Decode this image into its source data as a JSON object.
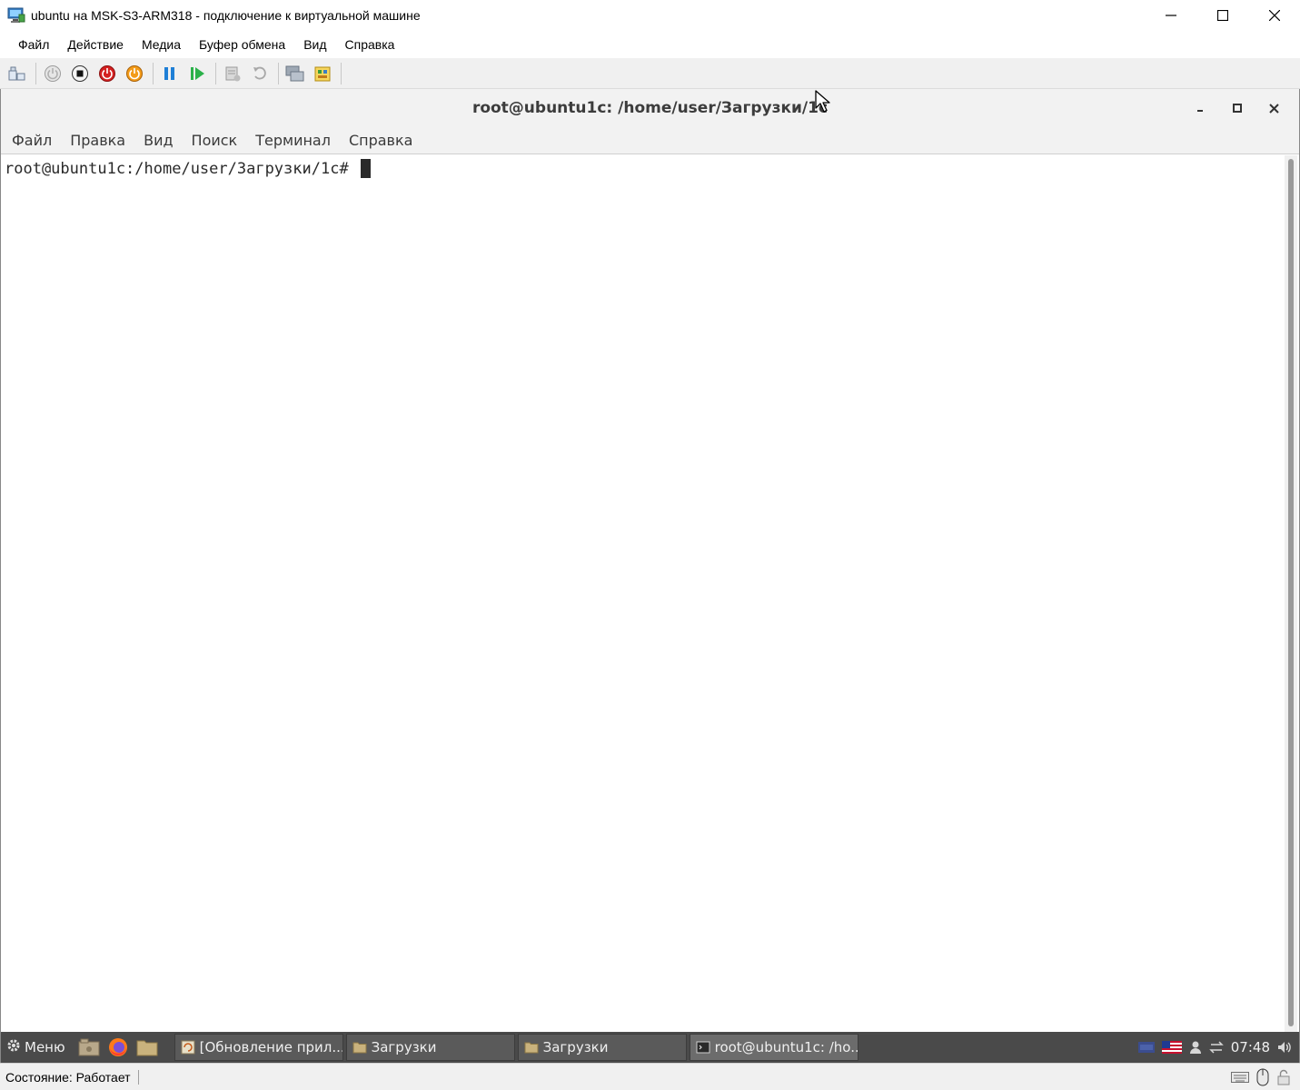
{
  "host": {
    "title": "ubuntu на MSK-S3-ARM318 - подключение к виртуальной машине",
    "menu": [
      "Файл",
      "Действие",
      "Медиа",
      "Буфер обмена",
      "Вид",
      "Справка"
    ],
    "toolbar_icons": [
      "ctrl-alt-del-icon",
      "start-icon",
      "turn-off-icon",
      "shutdown-icon",
      "save-state-icon",
      "pause-icon",
      "resume-icon",
      "checkpoint-icon",
      "revert-icon",
      "enhanced-session-icon",
      "share-icon"
    ],
    "status": "Состояние: Работает"
  },
  "terminal": {
    "title": "root@ubuntu1c: /home/user/Загрузки/1c",
    "menu": [
      "Файл",
      "Правка",
      "Вид",
      "Поиск",
      "Терминал",
      "Справка"
    ],
    "prompt": "root@ubuntu1c:/home/user/Загрузки/1c#"
  },
  "taskbar": {
    "menu_label": "Меню",
    "tasks": [
      {
        "label": "[Обновление прил...",
        "icon": "update-icon"
      },
      {
        "label": "Загрузки",
        "icon": "folder-icon"
      },
      {
        "label": "Загрузки",
        "icon": "folder-icon"
      },
      {
        "label": "root@ubuntu1c: /ho...",
        "icon": "terminal-icon"
      }
    ],
    "clock": "07:48"
  },
  "colors": {
    "taskbar_bg": "#4a4a4a",
    "terminal_title_bg": "#f2f2f2",
    "toolbar_bg": "#f0f0f0"
  }
}
